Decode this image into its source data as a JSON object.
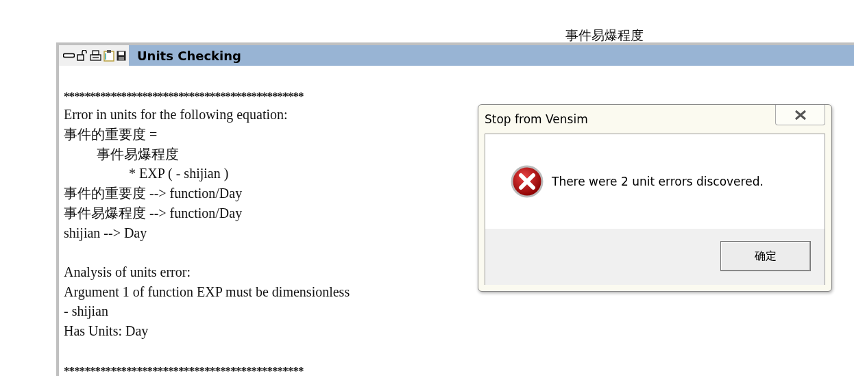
{
  "floating_label": "事件易爆程度",
  "window": {
    "title": "Units Checking",
    "lines": [
      {
        "kind": "gap"
      },
      {
        "kind": "plain",
        "text": "**********************************************"
      },
      {
        "kind": "plain",
        "text": "Error in units for the following equation:"
      },
      {
        "kind": "plain",
        "text": "事件的重要度 ="
      },
      {
        "kind": "indent1",
        "text": "事件易爆程度"
      },
      {
        "kind": "indent2",
        "text": "* EXP ( - shijian )"
      },
      {
        "kind": "plain",
        "text": "事件的重要度 --> function/Day"
      },
      {
        "kind": "plain",
        "text": "事件易爆程度 --> function/Day"
      },
      {
        "kind": "plain",
        "text": "shijian --> Day"
      },
      {
        "kind": "gap"
      },
      {
        "kind": "plain",
        "text": "Analysis of units error:"
      },
      {
        "kind": "plain",
        "text": "Argument 1 of function EXP must be dimensionless"
      },
      {
        "kind": "plain",
        "text": "- shijian"
      },
      {
        "kind": "plain",
        "text": "Has Units: Day"
      },
      {
        "kind": "gap"
      },
      {
        "kind": "plain",
        "text": "**********************************************"
      }
    ]
  },
  "dialog": {
    "title": "Stop from Vensim",
    "message": "There were 2 unit errors discovered.",
    "buttons": [
      "确定"
    ]
  }
}
